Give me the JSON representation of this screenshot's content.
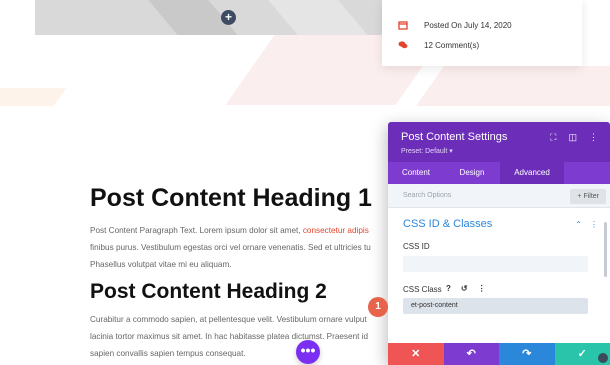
{
  "meta_card": {
    "date_text": "Posted On July 14, 2020",
    "comments_text": "12 Comment(s)",
    "icon_color": "#e3452f"
  },
  "featured_add_glyph": "+",
  "post": {
    "heading_1": "Post Content Heading 1",
    "para_1_line_1_text": "Post Content Paragraph Text. Lorem ipsum dolor sit amet, ",
    "para_1_line_1_link": "consectetur adipis",
    "para_1_line_2": "finibus purus. Vestibulum egestas orci vel ornare venenatis. Sed et ultricies tu",
    "para_1_line_3": "Phasellus volutpat vitae mi eu aliquam.",
    "heading_2": "Post Content Heading 2",
    "para_2_line_1": "Curabitur a commodo sapien, at pellentesque velit. Vestibulum ornare vulput",
    "para_2_line_2": "lacinia tortor maximus sit amet. In hac habitasse platea dictumst. Praesent id",
    "para_2_line_3": "sapien convallis sapien tempus consequat.",
    "more_glyph": "•••"
  },
  "panel": {
    "title": "Post Content Settings",
    "preset": "Preset: Default ▾",
    "tabs": [
      {
        "label": "Content"
      },
      {
        "label": "Design"
      },
      {
        "label": "Advanced"
      }
    ],
    "search_placeholder": "Search Options",
    "filter_label": "+ Filter",
    "group_title": "CSS ID & Classes",
    "css_id_label": "CSS ID",
    "css_id_value": "",
    "css_class_label": "CSS Class",
    "css_class_value": "et-post-content",
    "footer": {
      "cancel": "✕",
      "undo": "↶",
      "redo": "↷",
      "save": "✓"
    }
  },
  "marker_number": "1",
  "colors": {
    "panel_header": "#6c2eb9",
    "panel_tabs": "#7e3bd0",
    "link_blue": "#2b87da",
    "cancel_red": "#ef5555",
    "save_green": "#29c4a9"
  }
}
